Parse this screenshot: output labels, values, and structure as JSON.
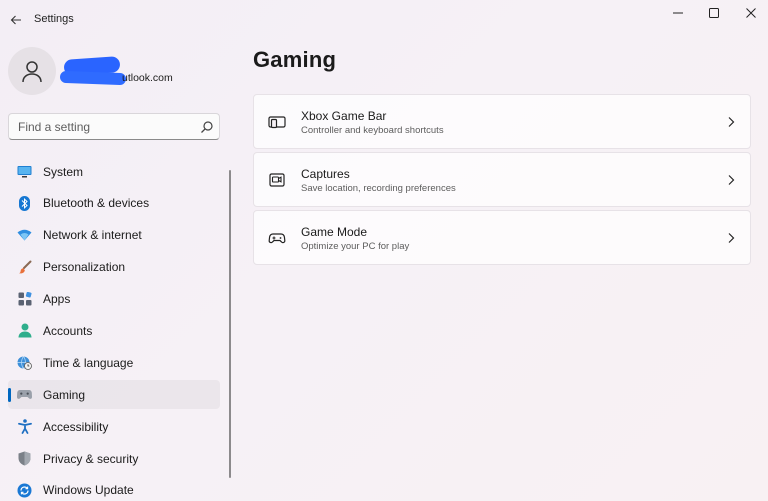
{
  "window": {
    "title": "Settings",
    "controls": {
      "minimize": "minimize-icon",
      "maximize": "maximize-icon",
      "close": "close-icon"
    }
  },
  "profile": {
    "email_visible_suffix": "utlook.com",
    "avatar_icon": "person-icon"
  },
  "search": {
    "placeholder": "Find a setting",
    "value": "",
    "icon": "search-icon"
  },
  "sidebar": {
    "items": [
      {
        "label": "System",
        "icon": "monitor-icon",
        "active": false
      },
      {
        "label": "Bluetooth & devices",
        "icon": "bluetooth-icon",
        "active": false
      },
      {
        "label": "Network & internet",
        "icon": "wifi-icon",
        "active": false
      },
      {
        "label": "Personalization",
        "icon": "brush-icon",
        "active": false
      },
      {
        "label": "Apps",
        "icon": "apps-icon",
        "active": false
      },
      {
        "label": "Accounts",
        "icon": "account-icon",
        "active": false
      },
      {
        "label": "Time & language",
        "icon": "globe-clock-icon",
        "active": false
      },
      {
        "label": "Gaming",
        "icon": "gamepad-icon",
        "active": true
      },
      {
        "label": "Accessibility",
        "icon": "accessibility-icon",
        "active": false
      },
      {
        "label": "Privacy & security",
        "icon": "shield-icon",
        "active": false
      },
      {
        "label": "Windows Update",
        "icon": "update-icon",
        "active": false
      }
    ]
  },
  "main": {
    "title": "Gaming",
    "cards": [
      {
        "title": "Xbox Game Bar",
        "subtitle": "Controller and keyboard shortcuts",
        "icon": "game-bar-icon"
      },
      {
        "title": "Captures",
        "subtitle": "Save location, recording preferences",
        "icon": "capture-icon"
      },
      {
        "title": "Game Mode",
        "subtitle": "Optimize your PC for play",
        "icon": "controller-icon"
      }
    ]
  },
  "colors": {
    "accent": "#0067c0",
    "redaction": "#2a64ff"
  }
}
